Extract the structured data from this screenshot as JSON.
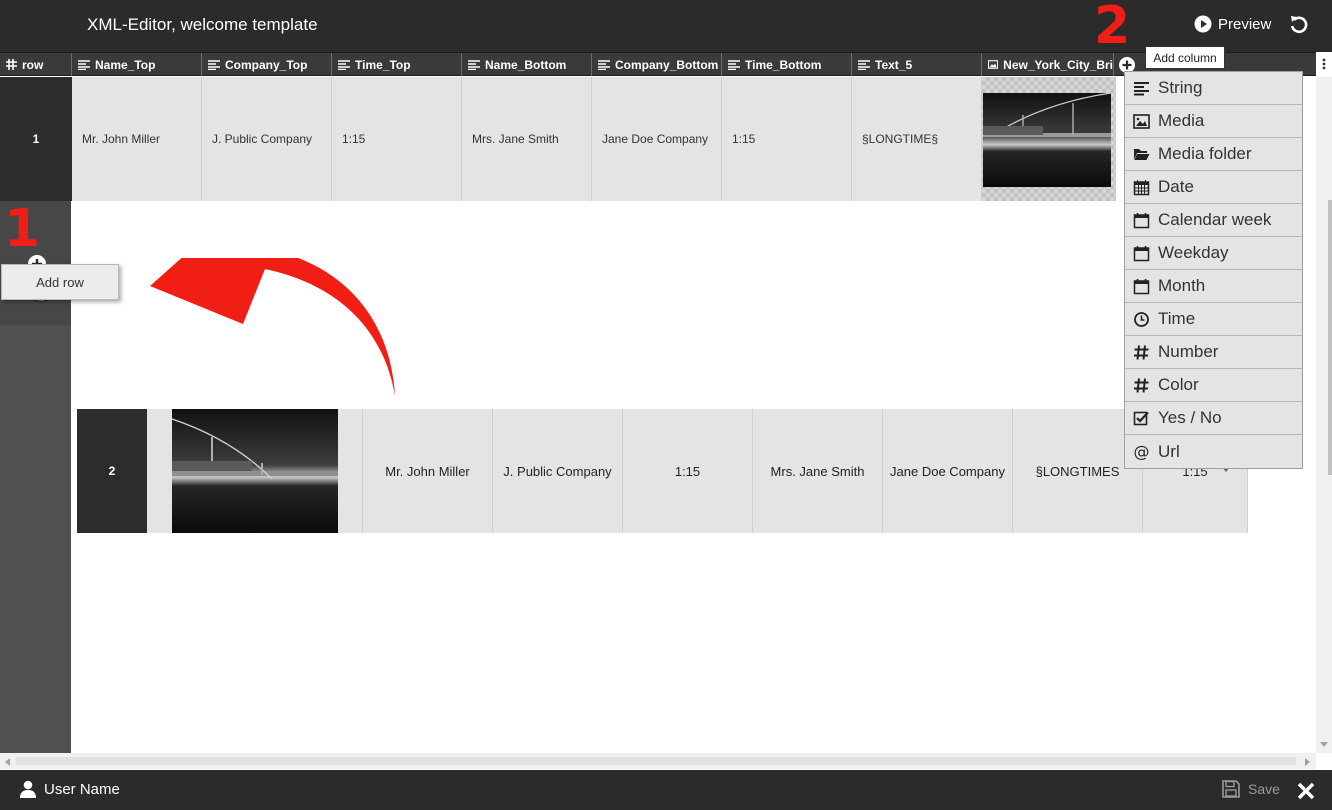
{
  "app": {
    "title": "XML-Editor, welcome template",
    "preview_label": "Preview"
  },
  "columns": [
    {
      "label": "row",
      "icon": "hash-icon"
    },
    {
      "label": "Name_Top",
      "icon": "text-lines-icon"
    },
    {
      "label": "Company_Top",
      "icon": "text-lines-icon"
    },
    {
      "label": "Time_Top",
      "icon": "text-lines-icon"
    },
    {
      "label": "Name_Bottom",
      "icon": "text-lines-icon"
    },
    {
      "label": "Company_Bottom",
      "icon": "text-lines-icon"
    },
    {
      "label": "Time_Bottom",
      "icon": "text-lines-icon"
    },
    {
      "label": "Text_5",
      "icon": "text-lines-icon"
    },
    {
      "label": "New_York_City_Bri",
      "icon": "image-icon"
    }
  ],
  "row1": {
    "number": "1",
    "cells": [
      "Mr. John Miller",
      "J. Public Company",
      "1:15",
      "Mrs. Jane Smith",
      "Jane Doe Company",
      "1:15",
      "§LONGTIME§"
    ]
  },
  "row2": {
    "number": "2",
    "cells": [
      "Mr. John Miller",
      "J. Public Company",
      "1:15",
      "Mrs. Jane Smith",
      "Jane Doe Company",
      "§LONGTIMES",
      "1:15"
    ]
  },
  "annotations": {
    "one": "1",
    "two": "2"
  },
  "tooltips": {
    "add_row": "Add row",
    "add_column": "Add column"
  },
  "column_types": [
    {
      "label": "String",
      "icon": "text-lines-icon"
    },
    {
      "label": "Media",
      "icon": "image-icon"
    },
    {
      "label": "Media folder",
      "icon": "folder-open-icon"
    },
    {
      "label": "Date",
      "icon": "calendar-grid-icon"
    },
    {
      "label": "Calendar week",
      "icon": "calendar-icon"
    },
    {
      "label": "Weekday",
      "icon": "calendar-icon"
    },
    {
      "label": "Month",
      "icon": "calendar-icon"
    },
    {
      "label": "Time",
      "icon": "clock-icon"
    },
    {
      "label": "Number",
      "icon": "hash-icon"
    },
    {
      "label": "Color",
      "icon": "hash-icon"
    },
    {
      "label": "Yes / No",
      "icon": "checkbox-icon"
    },
    {
      "label": "Url",
      "icon": "at-icon"
    }
  ],
  "footer": {
    "user_name": "User Name",
    "save_label": "Save"
  },
  "colors": {
    "annotation_red": "#f01e14",
    "bar_dark": "#2b2b2b",
    "cell_bg": "#e4e4e4"
  }
}
